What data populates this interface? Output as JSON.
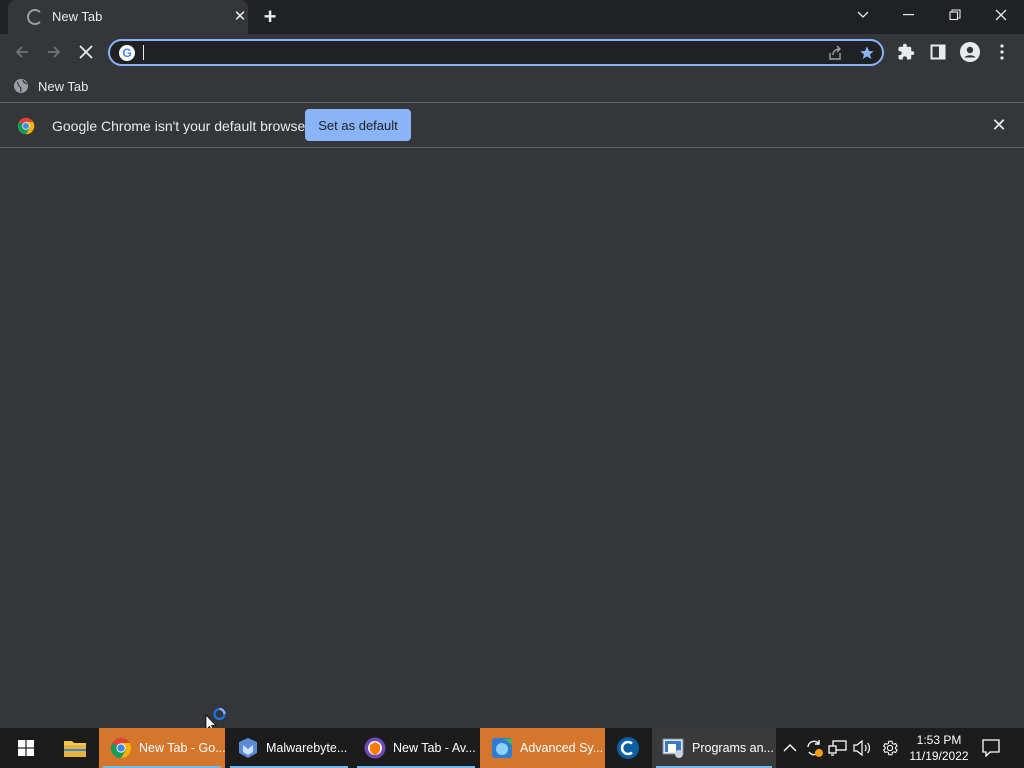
{
  "browser": {
    "tab": {
      "title": "New Tab"
    },
    "omnibox": {
      "value": "",
      "placeholder": ""
    },
    "bookmarks": [
      {
        "label": "New Tab"
      }
    ],
    "infobar": {
      "message": "Google Chrome isn't your default browser",
      "button_label": "Set as default"
    }
  },
  "taskbar": {
    "items": [
      {
        "label": "New Tab - Go...",
        "icon": "chrome-icon",
        "active": true
      },
      {
        "label": "Malwarebyte...",
        "icon": "malwarebytes-icon",
        "active": false
      },
      {
        "label": "New Tab - Av...",
        "icon": "avast-browser-icon",
        "active": false
      },
      {
        "label": "Advanced Sy...",
        "icon": "advanced-systemcare-icon",
        "active": true
      },
      {
        "label": "Programs an...",
        "icon": "programs-features-icon",
        "active": false
      }
    ],
    "clock": {
      "time": "1:53 PM",
      "date": "11/19/2022"
    }
  },
  "colors": {
    "accent": "#8ab4f8",
    "taskbar_active": "#d4762c",
    "taskbar_bg": "#1c1c1c",
    "content_bg": "#35363a"
  }
}
